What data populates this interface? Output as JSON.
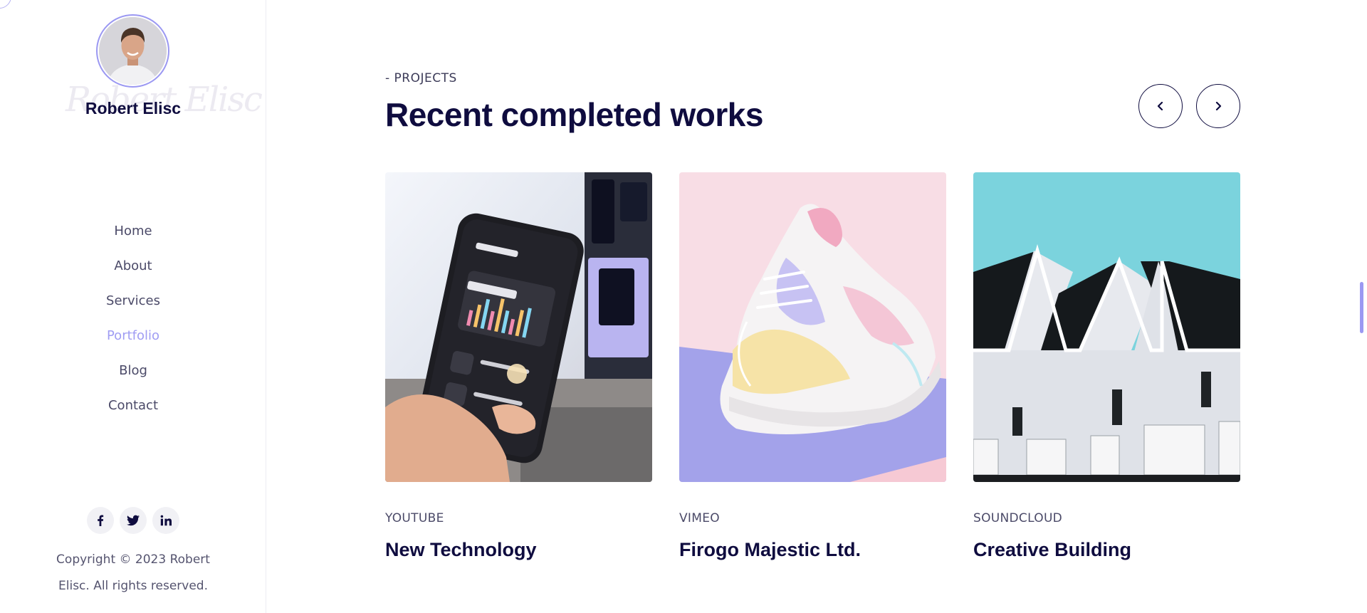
{
  "profile": {
    "name": "Robert Elisc",
    "signature": "Robert Elisc"
  },
  "nav": {
    "items": [
      {
        "label": "Home"
      },
      {
        "label": "About"
      },
      {
        "label": "Services"
      },
      {
        "label": "Portfolio",
        "active": true
      },
      {
        "label": "Blog"
      },
      {
        "label": "Contact"
      }
    ]
  },
  "socials": [
    {
      "icon": "facebook-icon"
    },
    {
      "icon": "twitter-icon"
    },
    {
      "icon": "linkedin-icon"
    }
  ],
  "copyright": {
    "line1": "Copyright © 2023 Robert",
    "line2": "Elisc. All rights reserved."
  },
  "section": {
    "eyebrow": "- PROJECTS",
    "title": "Recent completed works"
  },
  "projects": [
    {
      "category": "YOUTUBE",
      "title": "New Technology"
    },
    {
      "category": "VIMEO",
      "title": "Firogo Majestic Ltd."
    },
    {
      "category": "SOUNDCLOUD",
      "title": "Creative Building"
    }
  ],
  "colors": {
    "accent": "#a09df3",
    "heading": "#0f0c3f",
    "text": "#4b4a68"
  }
}
